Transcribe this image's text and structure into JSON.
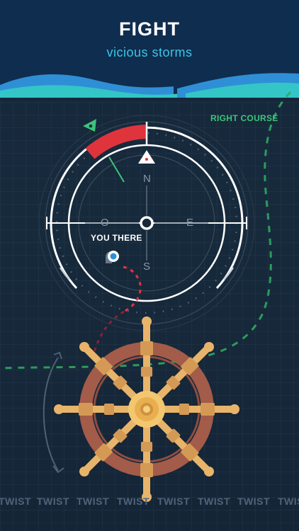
{
  "header": {
    "title": "FIGHT",
    "subtitle": "vicious storms"
  },
  "compass": {
    "right_course_label": "RIGHT COURSE",
    "you_label": "YOU THERE",
    "directions": {
      "north": "N",
      "south": "S",
      "east": "E",
      "west": "O"
    }
  },
  "footer": {
    "twist_label": "TWIST",
    "twist_repeat": [
      "TWIST",
      "TWIST",
      "TWIST",
      "TWIST",
      "TWIST",
      "TWIST",
      "TWIST",
      "TWIST"
    ]
  },
  "colors": {
    "background": "#152435",
    "header": "#0f2d4f",
    "accent_cyan": "#39c7e6",
    "accent_green": "#3dc47a",
    "warning_red": "#e0343d",
    "wheel_rim": "#a35b4a",
    "wheel_gold": "#e8b46a"
  },
  "icons": [
    "green-flag-icon",
    "triangle-marker-icon",
    "location-pin-icon",
    "rotate-arrow-icon",
    "ship-wheel-icon"
  ]
}
